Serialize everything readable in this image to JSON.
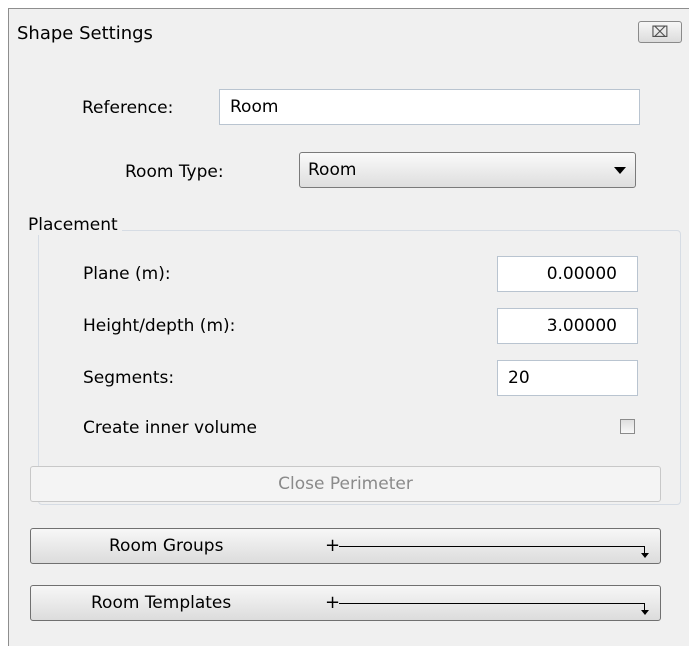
{
  "window": {
    "title": "Shape Settings",
    "close_glyph": "⌧"
  },
  "reference": {
    "label": "Reference:",
    "value": "Room"
  },
  "room_type": {
    "label": "Room Type:",
    "selected": "Room"
  },
  "placement": {
    "caption": "Placement",
    "plane_label": "Plane (m):",
    "plane_value": "0.00000",
    "height_label": "Height/depth (m):",
    "height_value": "3.00000",
    "segments_label": "Segments:",
    "segments_value": "20",
    "inner_volume_label": "Create inner volume",
    "inner_volume_checked": false
  },
  "buttons": {
    "close_perimeter": "Close  Perimeter",
    "room_groups": "Room Groups",
    "room_templates": "Room Templates",
    "plus_glyph": "+"
  }
}
